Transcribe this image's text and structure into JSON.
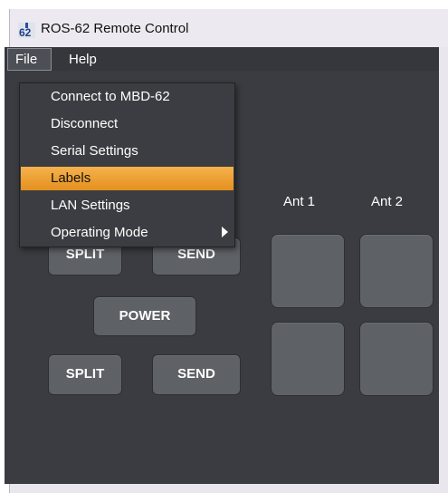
{
  "window": {
    "title": "ROS-62 Remote Control",
    "icon": "app-logo-icon"
  },
  "menubar": {
    "file_label": "File",
    "help_label": "Help"
  },
  "file_menu": {
    "items": [
      {
        "label": "Connect to MBD-62"
      },
      {
        "label": "Disconnect"
      },
      {
        "label": "Serial Settings"
      },
      {
        "label": "Labels",
        "highlighted": true
      },
      {
        "label": "LAN Settings"
      },
      {
        "label": "Operating Mode",
        "has_submenu": true
      }
    ]
  },
  "panel": {
    "ant1_label": "Ant 1",
    "ant2_label": "Ant 2",
    "split_top_label": "SPLIT",
    "send_top_label": "SEND",
    "power_label": "POWER",
    "split_bottom_label": "SPLIT",
    "send_bottom_label": "SEND"
  },
  "colors": {
    "panel_bg": "#3a3c41",
    "button_bg": "#5e6166",
    "menu_highlight": "#ee9f32",
    "text": "#ffffff"
  }
}
